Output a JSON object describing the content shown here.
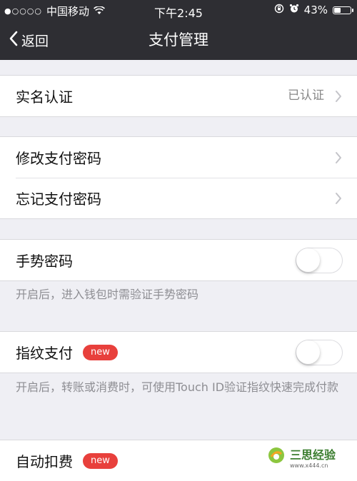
{
  "status_bar": {
    "carrier": "中国移动",
    "time": "下午2:45",
    "battery": "43%",
    "battery_level": 0.43,
    "icons": [
      "signal-dots-icon",
      "wifi-icon",
      "rotation-lock-icon",
      "alarm-icon",
      "battery-icon"
    ]
  },
  "nav": {
    "back_label": "返回",
    "title": "支付管理"
  },
  "rows": {
    "real_name": {
      "label": "实名认证",
      "value": "已认证"
    },
    "change_password": {
      "label": "修改支付密码"
    },
    "forgot_password": {
      "label": "忘记支付密码"
    },
    "gesture": {
      "label": "手势密码",
      "enabled": false,
      "note": "开启后，进入钱包时需验证手势密码"
    },
    "fingerprint": {
      "label": "指纹支付",
      "badge": "new",
      "enabled": false,
      "note": "开启后，转账或消费时，可使用Touch ID验证指纹快速完成付款"
    },
    "auto_debit": {
      "label": "自动扣费",
      "badge": "new"
    }
  },
  "watermark": {
    "text": "三思经验",
    "url": "www.x444.cn"
  },
  "colors": {
    "nav_bg": "#2e2e33",
    "page_bg": "#efeff4",
    "badge": "#e8403c"
  }
}
